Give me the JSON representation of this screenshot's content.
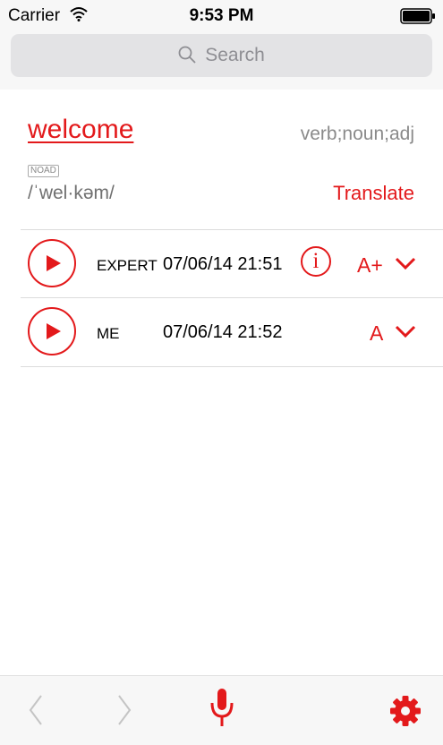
{
  "status_bar": {
    "carrier": "Carrier",
    "time": "9:53 PM"
  },
  "search": {
    "placeholder": "Search"
  },
  "entry": {
    "word": "welcome",
    "parts_of_speech": "verb;noun;adj",
    "dictionary": "NOAD",
    "pronunciation": "/ˈwel·kəm/",
    "translate_label": "Translate"
  },
  "recordings": [
    {
      "label": "EXPERT",
      "datetime": "07/06/14 21:51",
      "grade": "A+",
      "has_info": true
    },
    {
      "label": "ME",
      "datetime": "07/06/14 21:52",
      "grade": "A",
      "has_info": false
    }
  ],
  "toolbar": {
    "icons": [
      "back-chevron-icon",
      "forward-chevron-icon",
      "microphone-icon",
      "gear-icon"
    ]
  },
  "colors": {
    "accent": "#e3191b",
    "bar_bg": "#f7f7f7",
    "muted": "#8a8a8a"
  }
}
